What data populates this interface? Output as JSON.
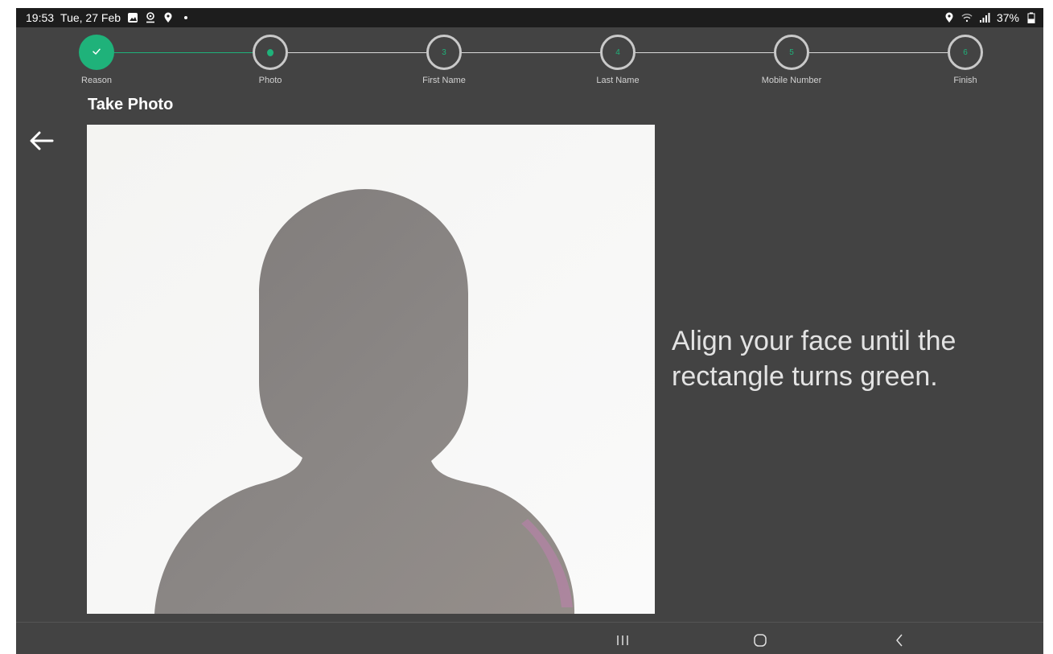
{
  "status": {
    "time": "19:53",
    "date": "Tue, 27 Feb",
    "battery": "37%",
    "left_icons": [
      "gallery-icon",
      "location-pin-icon",
      "map-marker-icon",
      "dot-icon"
    ],
    "right_icons": [
      "location-icon",
      "wifi-icon",
      "signal-icon",
      "battery-icon"
    ]
  },
  "stepper": {
    "steps": [
      {
        "number": "",
        "label": "Reason",
        "state": "done",
        "icon": "check-icon"
      },
      {
        "number": "",
        "label": "Photo",
        "state": "current"
      },
      {
        "number": "3",
        "label": "First Name",
        "state": "pending"
      },
      {
        "number": "4",
        "label": "Last Name",
        "state": "pending"
      },
      {
        "number": "5",
        "label": "Mobile Number",
        "state": "pending"
      },
      {
        "number": "6",
        "label": "Finish",
        "state": "pending"
      }
    ],
    "accent_color": "#1fb27a"
  },
  "page": {
    "title": "Take Photo",
    "instruction": "Align your face until the rectangle turns green."
  },
  "navigation": {
    "back_icon": "arrow-left-icon",
    "system_buttons": [
      "recent-apps-icon",
      "home-icon",
      "back-icon"
    ]
  }
}
